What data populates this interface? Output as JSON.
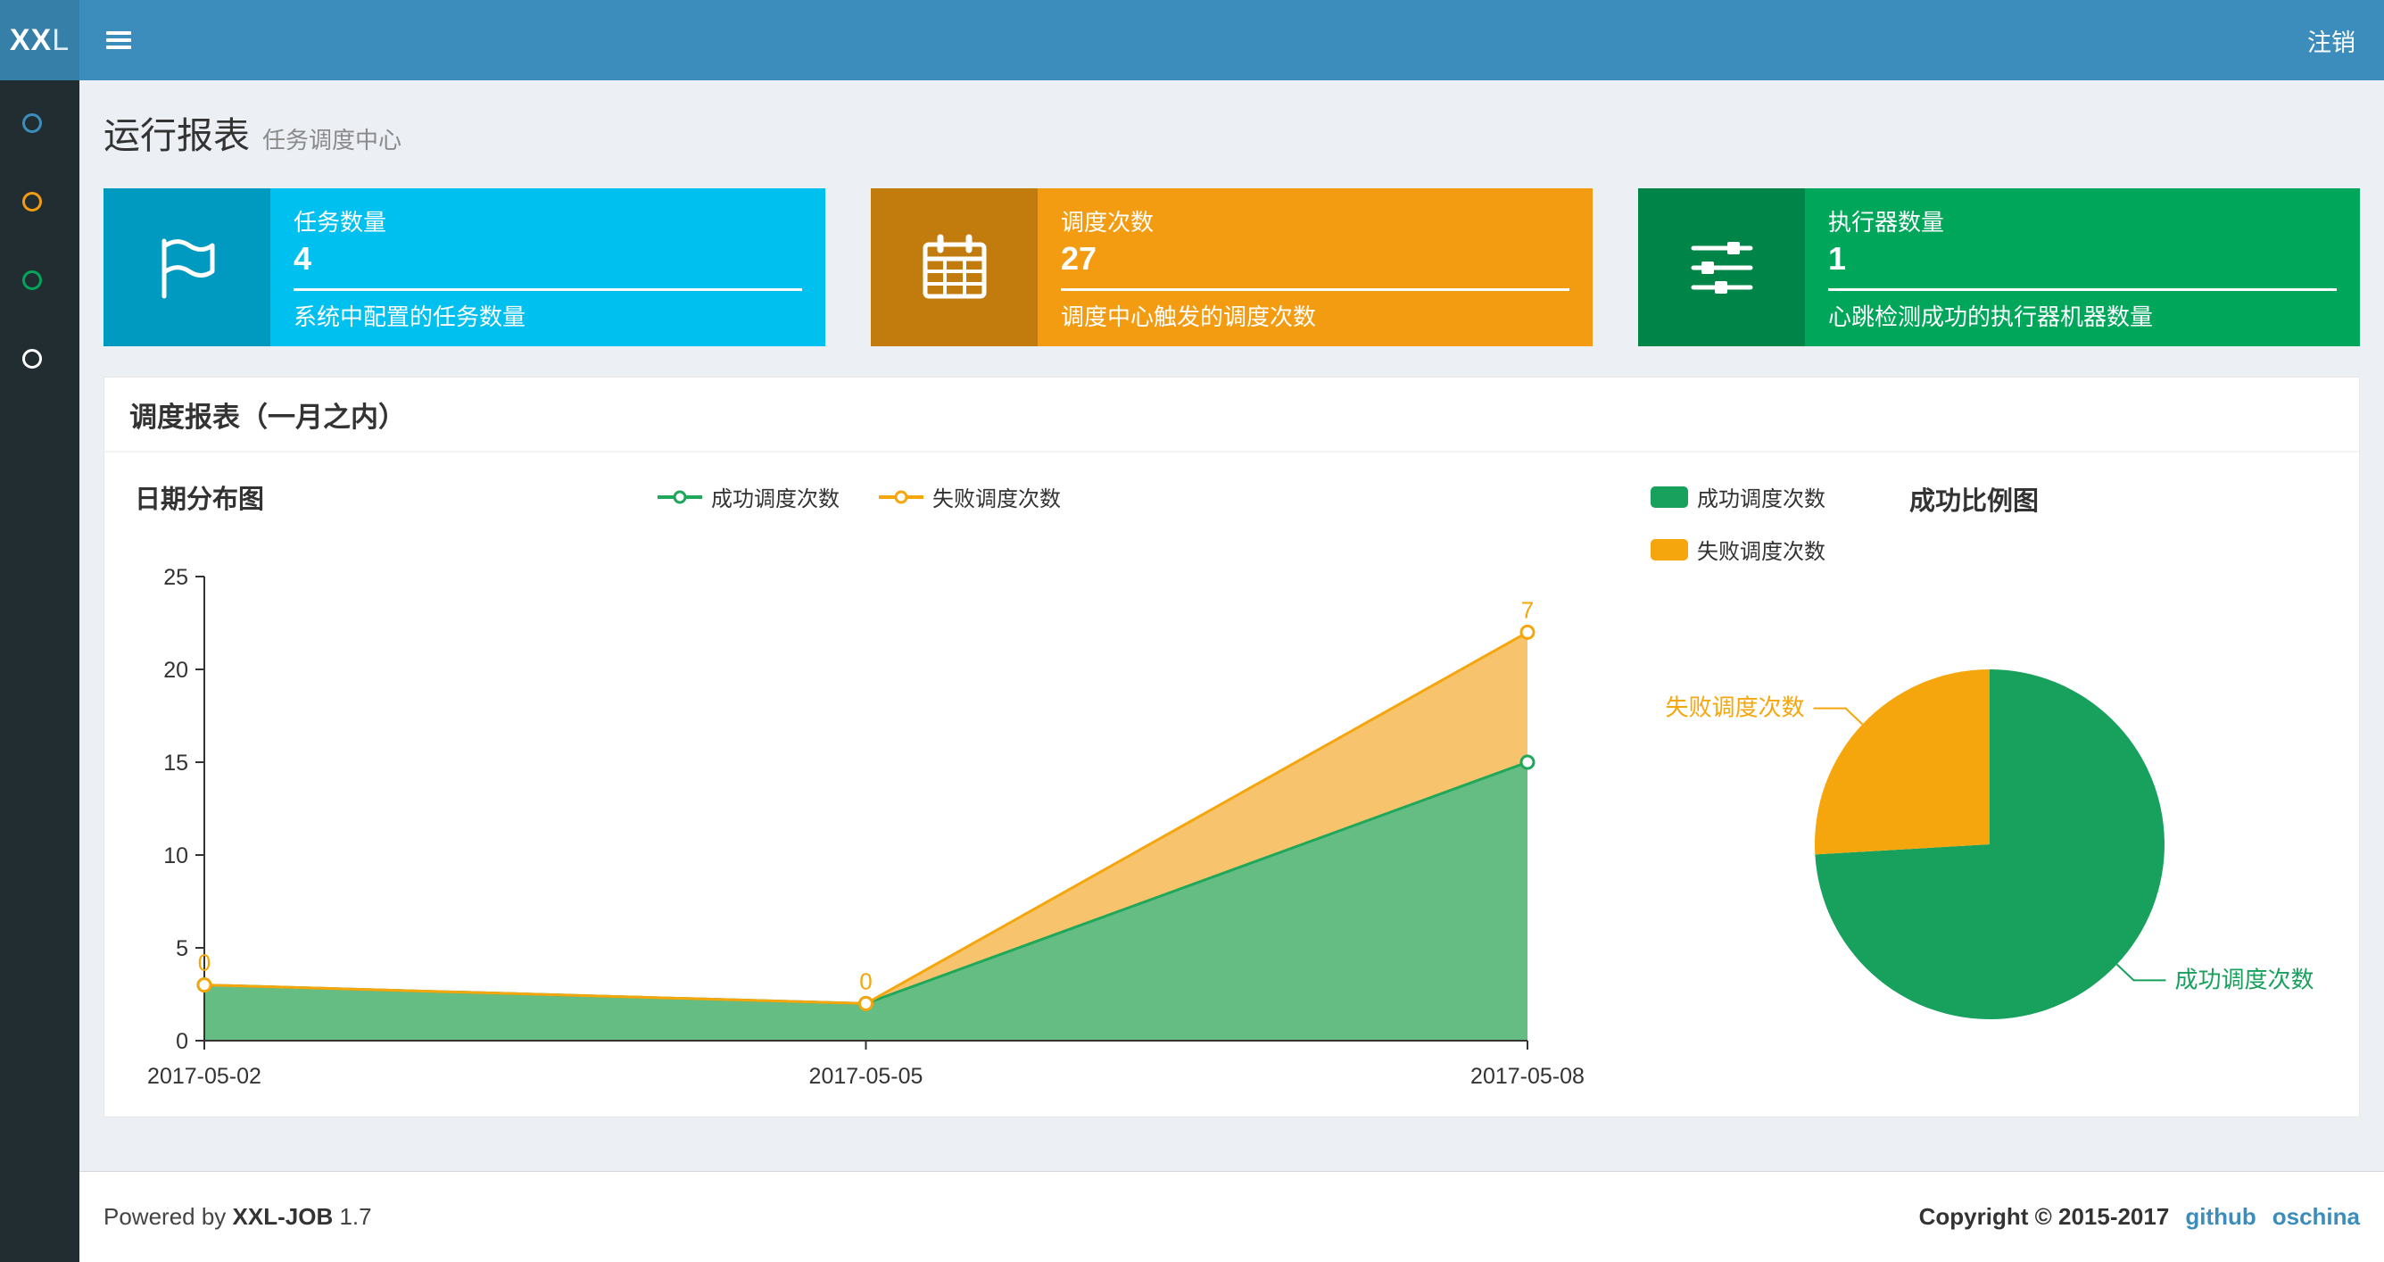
{
  "navbar": {
    "logo_bold": "XX",
    "logo_light": "L",
    "logout": "注销"
  },
  "sidebar": {
    "items": [
      {
        "color": "#3c8dbc"
      },
      {
        "color": "#f39c12"
      },
      {
        "color": "#00a65a"
      },
      {
        "color": "#ffffff"
      }
    ]
  },
  "header": {
    "title": "运行报表",
    "subtitle": "任务调度中心"
  },
  "info_boxes": [
    {
      "label": "任务数量",
      "value": "4",
      "desc": "系统中配置的任务数量",
      "bg": "#00c0ef",
      "icon": "flag-icon"
    },
    {
      "label": "调度次数",
      "value": "27",
      "desc": "调度中心触发的调度次数",
      "bg": "#f39c12",
      "icon": "calendar-icon"
    },
    {
      "label": "执行器数量",
      "value": "1",
      "desc": "心跳检测成功的执行器机器数量",
      "bg": "#00a65a",
      "icon": "sliders-icon"
    }
  ],
  "panel": {
    "title": "调度报表（一月之内）"
  },
  "chart_data": [
    {
      "type": "area",
      "title": "日期分布图",
      "x": [
        "2017-05-02",
        "2017-05-05",
        "2017-05-08"
      ],
      "series": [
        {
          "name": "成功调度次数",
          "values": [
            3,
            2,
            15
          ],
          "color": "#1fa75a",
          "fill": "rgba(94,185,125,0.95)"
        },
        {
          "name": "失败调度次数",
          "values": [
            0,
            0,
            7
          ],
          "color": "#f5a60c",
          "fill": "rgba(246,189,93,0.9)",
          "point_labels": [
            "0",
            "0",
            "7"
          ]
        }
      ],
      "stacked": true,
      "ylim": [
        0,
        25
      ],
      "y_ticks": [
        0,
        5,
        10,
        15,
        20,
        25
      ],
      "xlabel": "",
      "ylabel": "",
      "grid": false,
      "legend_position": "top-center"
    },
    {
      "type": "pie",
      "title": "成功比例图",
      "slices": [
        {
          "name": "成功调度次数",
          "value": 20,
          "color": "#18a05d"
        },
        {
          "name": "失败调度次数",
          "value": 7,
          "color": "#f5a60c"
        }
      ],
      "legend_position": "top-left"
    }
  ],
  "footer": {
    "powered_prefix": "Powered by ",
    "brand": "XXL-JOB",
    "version": " 1.7",
    "copyright": "Copyright © 2015-2017",
    "links": [
      "github",
      "oschina"
    ]
  },
  "colors": {
    "navbar": "#3c8dbc",
    "navbar_logo": "#367fa9",
    "sidebar": "#222d32",
    "content_bg": "#ecf0f5",
    "link": "#3c8dbc"
  }
}
